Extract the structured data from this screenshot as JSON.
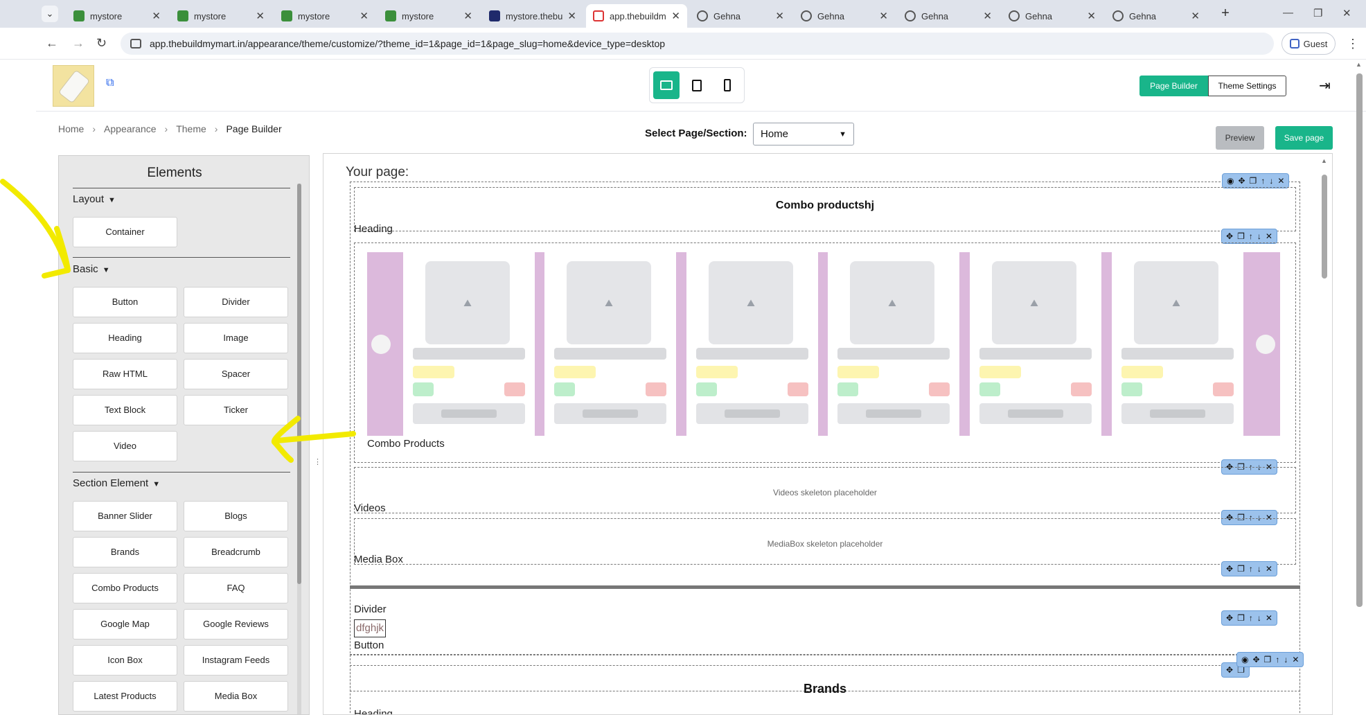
{
  "browser": {
    "tabs": [
      {
        "title": "mystore",
        "favicon": "store-icon",
        "active": false
      },
      {
        "title": "mystore",
        "favicon": "store-icon",
        "active": false
      },
      {
        "title": "mystore",
        "favicon": "store-icon",
        "active": false
      },
      {
        "title": "mystore",
        "favicon": "store-icon",
        "active": false
      },
      {
        "title": "mystore.thebu",
        "favicon": "doc-icon",
        "active": false
      },
      {
        "title": "app.thebuildm",
        "favicon": "pin-icon",
        "active": true
      },
      {
        "title": "Gehna",
        "favicon": "globe-icon",
        "active": false
      },
      {
        "title": "Gehna",
        "favicon": "globe-icon",
        "active": false
      },
      {
        "title": "Gehna",
        "favicon": "globe-icon",
        "active": false
      },
      {
        "title": "Gehna",
        "favicon": "globe-icon",
        "active": false
      },
      {
        "title": "Gehna",
        "favicon": "globe-icon",
        "active": false
      }
    ],
    "url": "app.thebuildmymart.in/appearance/theme/customize/?theme_id=1&page_id=1&page_slug=home&device_type=desktop",
    "profile_label": "Guest"
  },
  "header": {
    "page_builder_label": "Page Builder",
    "theme_settings_label": "Theme Settings"
  },
  "breadcrumb": [
    "Home",
    "Appearance",
    "Theme",
    "Page Builder"
  ],
  "page_select": {
    "label": "Select Page/Section:",
    "value": "Home"
  },
  "actions": {
    "preview_label": "Preview",
    "save_label": "Save page"
  },
  "elements_panel": {
    "title": "Elements",
    "sections": [
      {
        "title": "Layout",
        "items": [
          "Container"
        ]
      },
      {
        "title": "Basic",
        "items": [
          "Button",
          "Divider",
          "Heading",
          "Image",
          "Raw HTML",
          "Spacer",
          "Text Block",
          "Ticker",
          "Video"
        ]
      },
      {
        "title": "Section Element",
        "items": [
          "Banner Slider",
          "Blogs",
          "Brands",
          "Breadcrumb",
          "Combo Products",
          "FAQ",
          "Google Map",
          "Google Reviews",
          "Icon Box",
          "Instagram Feeds",
          "Latest Products",
          "Media Box"
        ]
      }
    ]
  },
  "canvas": {
    "heading": "Your page:",
    "combo_title": "Combo productshj",
    "heading_label": "Heading",
    "combo_label": "Combo Products",
    "videos_placeholder": "Videos skeleton placeholder",
    "videos_label": "Videos",
    "mediabox_placeholder": "MediaBox skeleton placeholder",
    "mediabox_label": "Media Box",
    "divider_label": "Divider",
    "sample_button_text": "dfghjk",
    "button_label": "Button",
    "brands_title": "Brands",
    "brands_heading_label": "Heading"
  },
  "colors": {
    "accent": "#19b58a",
    "annotation": "#f2ea00",
    "slider_bg": "#dcb9dc",
    "block_toolbar": "#9cc2ec"
  }
}
